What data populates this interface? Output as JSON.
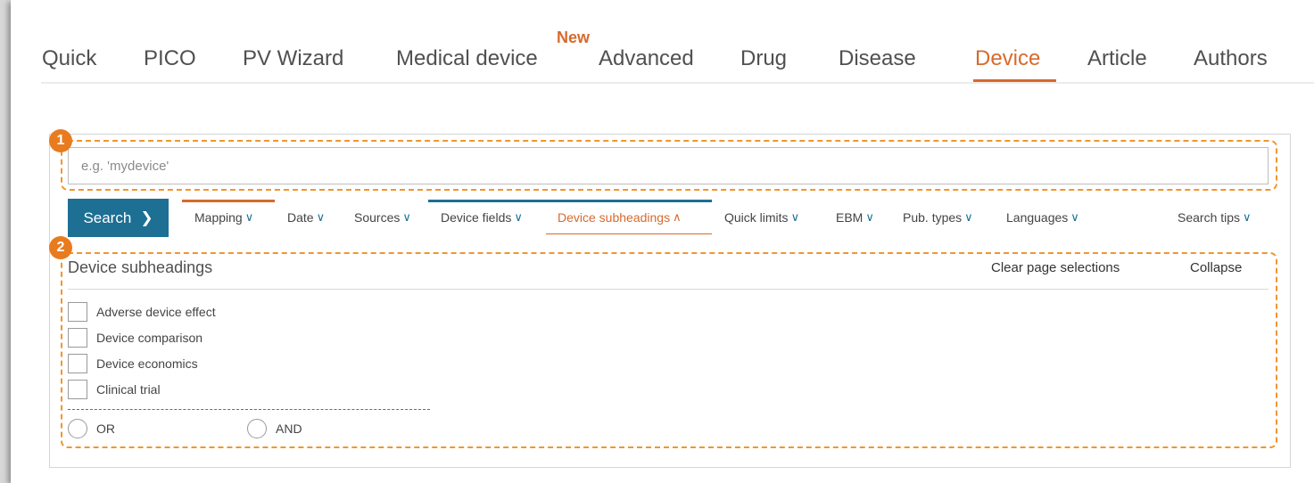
{
  "tabs": [
    {
      "label": "Quick"
    },
    {
      "label": "PICO"
    },
    {
      "label": "PV Wizard"
    },
    {
      "label": "Medical device"
    },
    {
      "label": "Advanced"
    },
    {
      "label": "Drug"
    },
    {
      "label": "Disease"
    },
    {
      "label": "Device"
    },
    {
      "label": "Article"
    },
    {
      "label": "Authors"
    }
  ],
  "active_tab": "Device",
  "new_badge": "New",
  "markers": [
    "1",
    "2"
  ],
  "search": {
    "placeholder": "e.g. 'mydevice'",
    "value": "",
    "button_label": "Search",
    "button_icon": "chevron-right-icon"
  },
  "filters": [
    {
      "label": "Mapping"
    },
    {
      "label": "Date"
    },
    {
      "label": "Sources"
    },
    {
      "label": "Device fields"
    },
    {
      "label": "Device subheadings",
      "open": true
    },
    {
      "label": "Quick limits"
    },
    {
      "label": "EBM"
    },
    {
      "label": "Pub. types"
    },
    {
      "label": "Languages"
    },
    {
      "label": "Search tips"
    }
  ],
  "subheadings": {
    "title": "Device subheadings",
    "clear_label": "Clear page selections",
    "collapse_label": "Collapse",
    "options": [
      {
        "label": "Adverse device effect",
        "checked": false
      },
      {
        "label": "Device comparison",
        "checked": false
      },
      {
        "label": "Device economics",
        "checked": false
      },
      {
        "label": "Clinical trial",
        "checked": false
      }
    ],
    "operators": [
      {
        "label": "OR",
        "selected": false
      },
      {
        "label": "AND",
        "selected": false
      }
    ]
  },
  "colors": {
    "accent_orange": "#d76a2c",
    "primary_blue": "#1d6f94",
    "highlight_dash": "#f0962f"
  }
}
